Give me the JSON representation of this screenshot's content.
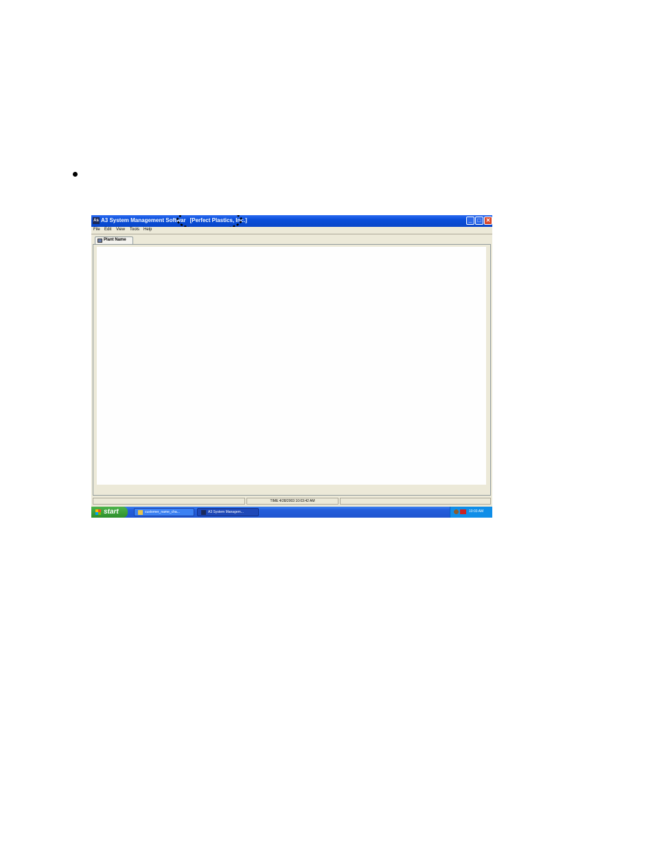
{
  "window": {
    "app_icon": "As",
    "title": "A3 System Management Softwar",
    "company": "[Perfect Plastics, Inc.]",
    "min_glyph": "_",
    "max_glyph": "□",
    "close_glyph": "✕"
  },
  "menu": [
    "File",
    "Edit",
    "View",
    "Tools",
    "Help"
  ],
  "tabs": [
    {
      "label": "Plant Name"
    }
  ],
  "status": {
    "time": "TIME   4/28/2003 10:03:42 AM"
  },
  "taskbar": {
    "start_label": "start",
    "tasks": [
      {
        "label": "customer_name_cha..."
      },
      {
        "label": "A3 System Managem..."
      }
    ],
    "clock": "10:03 AM"
  },
  "colors": {
    "titlebar": "#0a4ed9",
    "close": "#d9482a",
    "start": "#2e8f2c",
    "tray": "#0f8ee8"
  }
}
